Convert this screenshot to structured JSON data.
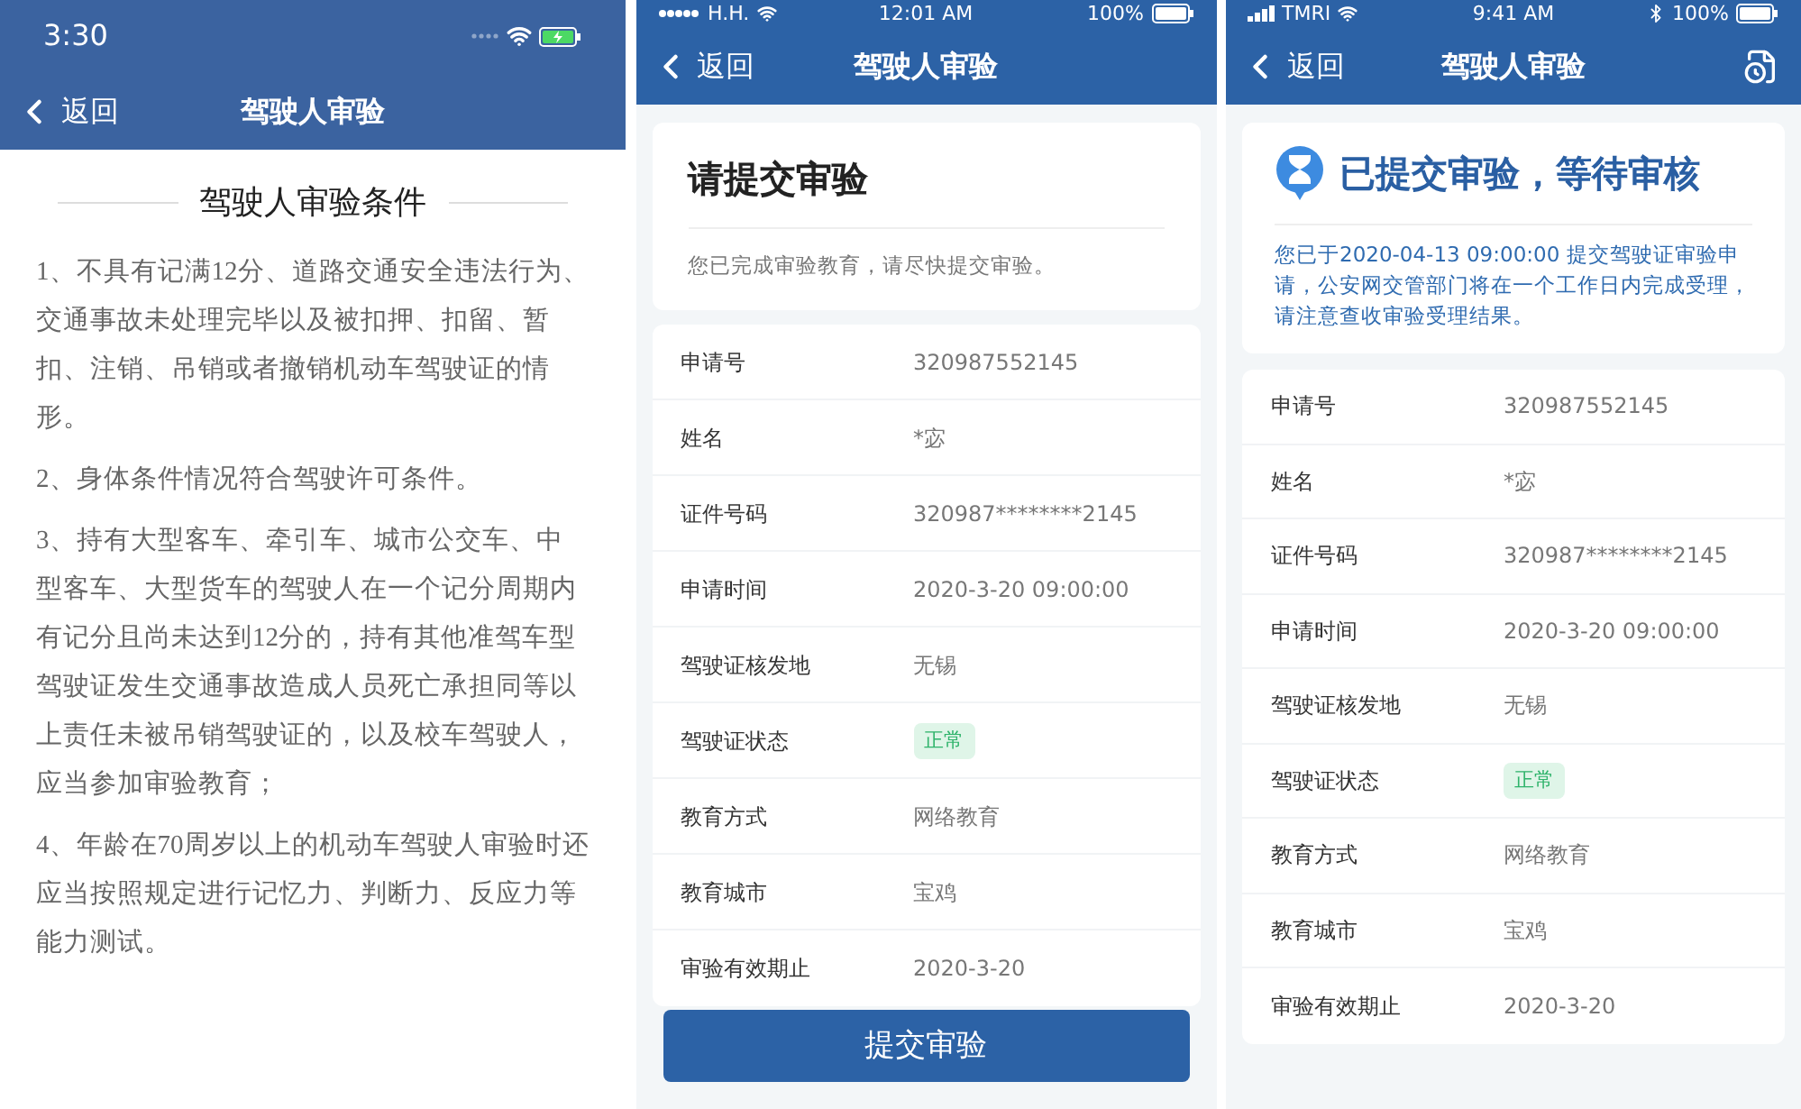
{
  "screens": [
    {
      "kind": "article",
      "status_bar": {
        "time": "3:30"
      },
      "nav": {
        "back": "返回",
        "title": "驾驶人审验"
      },
      "heading": "驾驶人审验条件",
      "paragraphs": [
        "1、不具有记满12分、道路交通安全违法行为、交通事故未处理完毕以及被扣押、扣留、暂扣、注销、吊销或者撤销机动车驾驶证的情形。",
        "2、身体条件情况符合驾驶许可条件。",
        "3、持有大型客车、牵引车、城市公交车、中型客车、大型货车的驾驶人在一个记分周期内有记分且尚未达到12分的，持有其他准驾车型驾驶证发生交通事故造成人员死亡承担同等以上责任未被吊销驾驶证的，以及校车驾驶人，应当参加审验教育；",
        "4、年龄在70周岁以上的机动车驾驶人审验时还应当按照规定进行记忆力、判断力、反应力等能力测试。"
      ]
    },
    {
      "kind": "submit",
      "status_bar": {
        "carrier": "H.H.",
        "time": "12:01 AM",
        "battery": "100%"
      },
      "nav": {
        "back": "返回",
        "title": "驾驶人审验"
      },
      "notice": {
        "title": "请提交审验",
        "message": "您已完成审验教育，请尽快提交审验。"
      },
      "fields": [
        {
          "label": "申请号",
          "value": "320987552145",
          "kind": "text"
        },
        {
          "label": "姓名",
          "value": "*宓",
          "kind": "text"
        },
        {
          "label": "证件号码",
          "value": "320987********2145",
          "kind": "text"
        },
        {
          "label": "申请时间",
          "value": "2020-3-20 09:00:00",
          "kind": "text"
        },
        {
          "label": "驾驶证核发地",
          "value": "无锡",
          "kind": "text"
        },
        {
          "label": "驾驶证状态",
          "value": "正常",
          "kind": "badge"
        },
        {
          "label": "教育方式",
          "value": "网络教育",
          "kind": "text"
        },
        {
          "label": "教育城市",
          "value": "宝鸡",
          "kind": "text"
        },
        {
          "label": "审验有效期止",
          "value": "2020-3-20",
          "kind": "text"
        }
      ],
      "submit_button": "提交审验"
    },
    {
      "kind": "pending",
      "status_bar": {
        "carrier": "TMRI",
        "time": "9:41 AM",
        "battery": "100%"
      },
      "nav": {
        "back": "返回",
        "title": "驾驶人审验"
      },
      "notice": {
        "title": "已提交审验，等待审核",
        "message": "您已于2020-04-13 09:00:00 提交驾驶证审验申请，公安网交管部门将在一个工作日内完成受理，请注意查收审验受理结果。"
      },
      "fields": [
        {
          "label": "申请号",
          "value": "320987552145",
          "kind": "text"
        },
        {
          "label": "姓名",
          "value": "*宓",
          "kind": "text"
        },
        {
          "label": "证件号码",
          "value": "320987********2145",
          "kind": "text"
        },
        {
          "label": "申请时间",
          "value": "2020-3-20 09:00:00",
          "kind": "text"
        },
        {
          "label": "驾驶证核发地",
          "value": "无锡",
          "kind": "text"
        },
        {
          "label": "驾驶证状态",
          "value": "正常",
          "kind": "badge"
        },
        {
          "label": "教育方式",
          "value": "网络教育",
          "kind": "text"
        },
        {
          "label": "教育城市",
          "value": "宝鸡",
          "kind": "text"
        },
        {
          "label": "审验有效期止",
          "value": "2020-3-20",
          "kind": "text"
        }
      ]
    }
  ]
}
